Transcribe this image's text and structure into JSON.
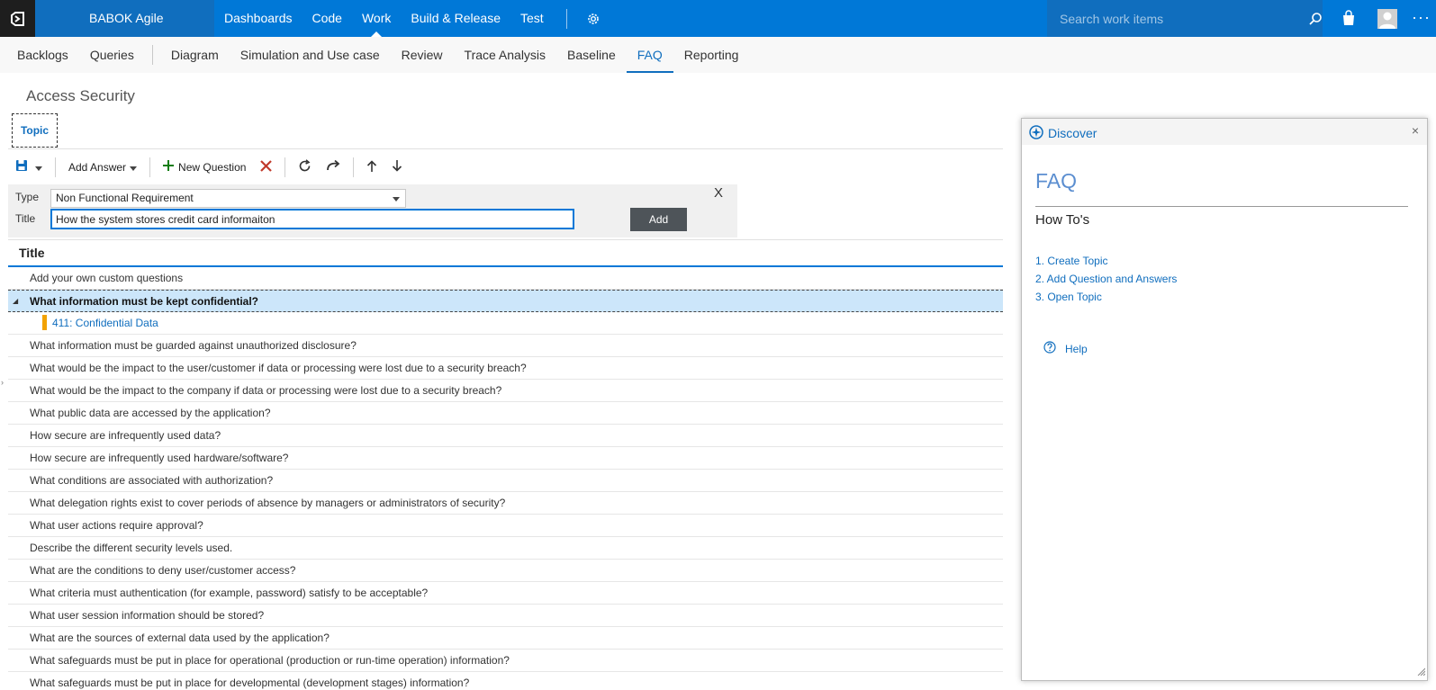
{
  "topbar": {
    "project_name": "BABOK Agile",
    "nav": [
      "Dashboards",
      "Code",
      "Work",
      "Build & Release",
      "Test"
    ],
    "active_nav": "Work",
    "search_placeholder": "Search work items",
    "icons": [
      "visual-studio-logo-icon",
      "gear-icon",
      "search-icon",
      "shopping-bag-icon",
      "user-avatar-icon",
      "more-ellipsis-icon"
    ],
    "ellipsis": "···"
  },
  "subnav": {
    "items": [
      "Backlogs",
      "Queries",
      "Diagram",
      "Simulation and Use case",
      "Review",
      "Trace Analysis",
      "Baseline",
      "FAQ",
      "Reporting"
    ],
    "active": "FAQ"
  },
  "page": {
    "title": "Access Security",
    "tab_label": "Topic"
  },
  "toolbar": {
    "add_answer_label": "Add Answer",
    "new_question_label": "New Question",
    "icons": [
      "save-icon",
      "dropdown-caret-icon",
      "plus-icon",
      "delete-x-icon",
      "refresh-icon",
      "redo-icon",
      "arrow-up-icon",
      "arrow-down-icon"
    ]
  },
  "add_form": {
    "type_label": "Type",
    "type_value": "Non Functional Requirement",
    "title_label": "Title",
    "title_value": "How the system stores credit card informaiton",
    "add_button_label": "Add",
    "close_label": "X"
  },
  "grid": {
    "header": "Title",
    "rows": [
      {
        "text": "Add your own custom questions",
        "kind": "normal"
      },
      {
        "text": "What information must be kept confidential?",
        "kind": "selected"
      },
      {
        "text": "411:  Confidential Data",
        "kind": "child"
      },
      {
        "text": "What information must be guarded against unauthorized disclosure?",
        "kind": "normal"
      },
      {
        "text": "What would be the impact to the user/customer if data or processing were lost due to a security breach?",
        "kind": "normal"
      },
      {
        "text": "What would be the impact to the company if data or processing were lost due to a security breach?",
        "kind": "normal"
      },
      {
        "text": "What public data are accessed by the application?",
        "kind": "normal"
      },
      {
        "text": "How secure are infrequently used data?",
        "kind": "normal"
      },
      {
        "text": "How secure are infrequently used hardware/software?",
        "kind": "normal"
      },
      {
        "text": "What conditions are associated with authorization?",
        "kind": "normal"
      },
      {
        "text": "What delegation rights exist to cover periods of absence by managers or administrators of security?",
        "kind": "normal"
      },
      {
        "text": "What user actions require approval?",
        "kind": "normal"
      },
      {
        "text": "Describe the different security levels used.",
        "kind": "normal"
      },
      {
        "text": "What are the conditions to deny user/customer access?",
        "kind": "normal"
      },
      {
        "text": "What criteria must authentication (for example, password) satisfy to be acceptable?",
        "kind": "normal"
      },
      {
        "text": "What user session information should be stored?",
        "kind": "normal"
      },
      {
        "text": "What are the sources of external data used by the application?",
        "kind": "normal"
      },
      {
        "text": "What safeguards must be put in place for operational (production or run-time operation) information?",
        "kind": "normal"
      },
      {
        "text": "What safeguards must be put in place for developmental (development stages) information?",
        "kind": "normal"
      }
    ]
  },
  "discover": {
    "title": "Discover",
    "close": "×",
    "faq_heading": "FAQ",
    "howto_heading": "How To's",
    "howto_items": [
      "1. Create Topic",
      "2. Add Question and Answers",
      "3. Open Topic"
    ],
    "help_label": "Help"
  },
  "colors": {
    "accent": "#0078d7",
    "accent_dark": "#106ebe",
    "selected_row": "#cce6fa",
    "child_marker": "#f2a200",
    "add_button": "#4e5459",
    "delete_icon": "#c0392b",
    "plus_icon": "#107c10"
  }
}
